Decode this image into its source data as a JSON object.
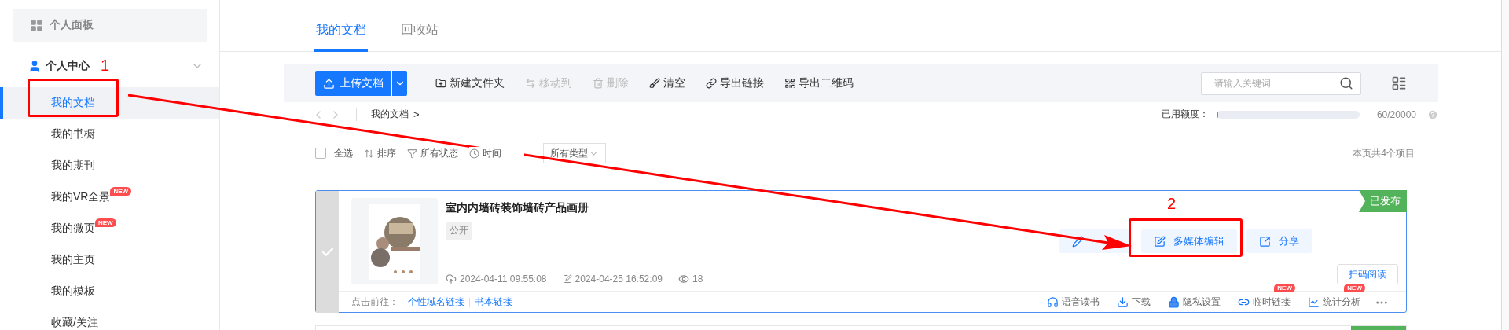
{
  "sidebar": {
    "panel": {
      "label": "个人面板"
    },
    "section": {
      "label": "个人中心",
      "expanded": true
    },
    "items": [
      {
        "label": "我的文档",
        "selected": true
      },
      {
        "label": "我的书橱",
        "selected": false
      },
      {
        "label": "我的期刊",
        "selected": false
      },
      {
        "label": "我的VR全景",
        "selected": false,
        "badge": "NEW"
      },
      {
        "label": "我的微页",
        "selected": false,
        "badge": "NEW"
      },
      {
        "label": "我的主页",
        "selected": false
      },
      {
        "label": "我的模板",
        "selected": false
      },
      {
        "label": "收藏/关注",
        "selected": false
      }
    ]
  },
  "tabs": [
    {
      "label": "我的文档",
      "selected": true
    },
    {
      "label": "回收站",
      "selected": false
    }
  ],
  "toolbar": {
    "upload": {
      "label": "上传文档"
    },
    "buttons": [
      {
        "label": "新建文件夹",
        "disabled": false
      },
      {
        "label": "移动到",
        "disabled": true
      },
      {
        "label": "删除",
        "disabled": true
      },
      {
        "label": "清空",
        "disabled": false
      },
      {
        "label": "导出链接",
        "disabled": false
      },
      {
        "label": "导出二维码",
        "disabled": false
      }
    ],
    "search": {
      "placeholder": "请输入关键词"
    }
  },
  "breadcrumb": {
    "items": [
      "我的文档"
    ],
    "separator": ">"
  },
  "quota": {
    "label": "已用额度：",
    "level": 0.003,
    "reading": "60/20000"
  },
  "filters": {
    "select_all": {
      "label": "全选",
      "checked": false
    },
    "sort": "排序",
    "status": "所有状态",
    "time": "时间",
    "type": "所有类型"
  },
  "count": "本页共4个项目",
  "document": {
    "title": "室内内墙砖装饰墙砖产品画册",
    "visibility": "公开",
    "status": "已发布",
    "selected": true,
    "uploaded": "2024-04-11 09:55:08",
    "modified": "2024-04-25 16:52:09",
    "views": "18",
    "buttons": [
      {
        "kind": "icon"
      },
      {
        "kind": "text",
        "label": "多媒体编辑"
      },
      {
        "kind": "text",
        "label": "分享"
      }
    ],
    "scan": "扫码阅读",
    "goto_label": "点击前往：",
    "links": [
      "个性域名链接",
      "书本链接"
    ],
    "actions": [
      {
        "label": "语音读书"
      },
      {
        "label": "下载"
      },
      {
        "label": "隐私设置"
      },
      {
        "label": "临时链接",
        "badge": "NEW"
      },
      {
        "label": "统计分析",
        "badge": "NEW"
      }
    ]
  },
  "annotations": [
    {
      "label": "1"
    },
    {
      "label": "2"
    }
  ]
}
